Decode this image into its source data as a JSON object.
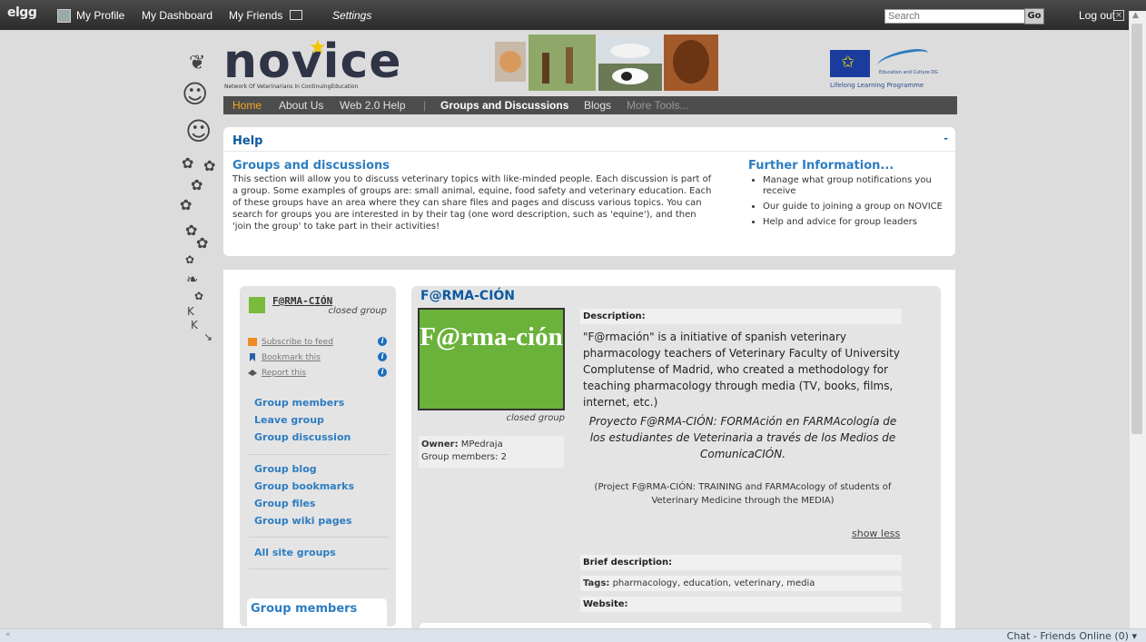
{
  "topbar": {
    "brand": "elgg",
    "my_profile": "My Profile",
    "my_dashboard": "My Dashboard",
    "my_friends": "My Friends",
    "settings": "Settings",
    "search_placeholder": "Search",
    "go": "Go",
    "logout": "Log out"
  },
  "header": {
    "logo": "novice",
    "tagline": "Network Of Veterinarians In ContinuingEducation",
    "eu_dg": "Education and Culture DG",
    "eu_programme": "Lifelong Learning Programme"
  },
  "nav": {
    "items": [
      "Home",
      "About Us",
      "Web 2.0 Help",
      "|",
      "Groups and Discussions",
      "Blogs",
      "More Tools..."
    ]
  },
  "help": {
    "title": "Help",
    "collapse": "-",
    "section_title": "Groups and discussions",
    "section_text": "This section will allow you to discuss veterinary topics with like-minded people. Each discussion is part of a group. Some examples of groups are: small animal, equine, food safety and veterinary education. Each of these groups have an area where they can share files and pages and discuss various topics. You can search for groups you are interested in by their tag (one word description, such as 'equine'), and then 'join the group' to take part in their activities!",
    "further_title": "Further Information...",
    "further_links": [
      "Manage what group notifications you receive",
      "Our guide to joining a group on NOVICE",
      "Help and advice for group leaders"
    ]
  },
  "sidebar": {
    "group_name": "F@RMA-CIÓN",
    "group_status": "closed group",
    "tools": [
      "Subscribe to feed",
      "Bookmark this",
      "Report this"
    ],
    "links_a": [
      "Group members",
      "Leave group",
      "Group discussion"
    ],
    "links_b": [
      "Group blog",
      "Group bookmarks",
      "Group files",
      "Group wiki pages"
    ],
    "links_c": [
      "All site groups"
    ],
    "members_box_title": "Group members"
  },
  "group": {
    "title": "F@RMA-CIÓN",
    "image_text": "F@rma-ción",
    "status": "closed group",
    "owner_label": "Owner:",
    "owner": "MPedraja",
    "members": "Group members: 2",
    "description_label": "Description:",
    "description": "\"F@rmación\" is a initiative of spanish veterinary pharmacology teachers of Veterinary Faculty of University Complutense of Madrid, who created a methodology for teaching pharmacology through media (TV, books, films, internet, etc.)",
    "description_es": "Proyecto F@RMA-CIÓN: FORMAción en FARMAcología de los estudiantes de Veterinaria a través de los Medios de ComunicaCIÓN.",
    "description_en": "(Project F@RMA-CIÓN: TRAINING and FARMAcology of students of Veterinary Medicine through the MEDIA)",
    "show_less": "show less",
    "brief_label": "Brief description:",
    "tags_label": "Tags:",
    "tags": [
      "pharmacology",
      "education",
      "veterinary",
      "media"
    ],
    "website_label": "Website:"
  },
  "statusbar": {
    "chat": "Chat - Friends Online (0)"
  },
  "colors": {
    "accent": "#2d7dc1",
    "title": "#0c5aa0",
    "nav_active": "#f5a623"
  }
}
